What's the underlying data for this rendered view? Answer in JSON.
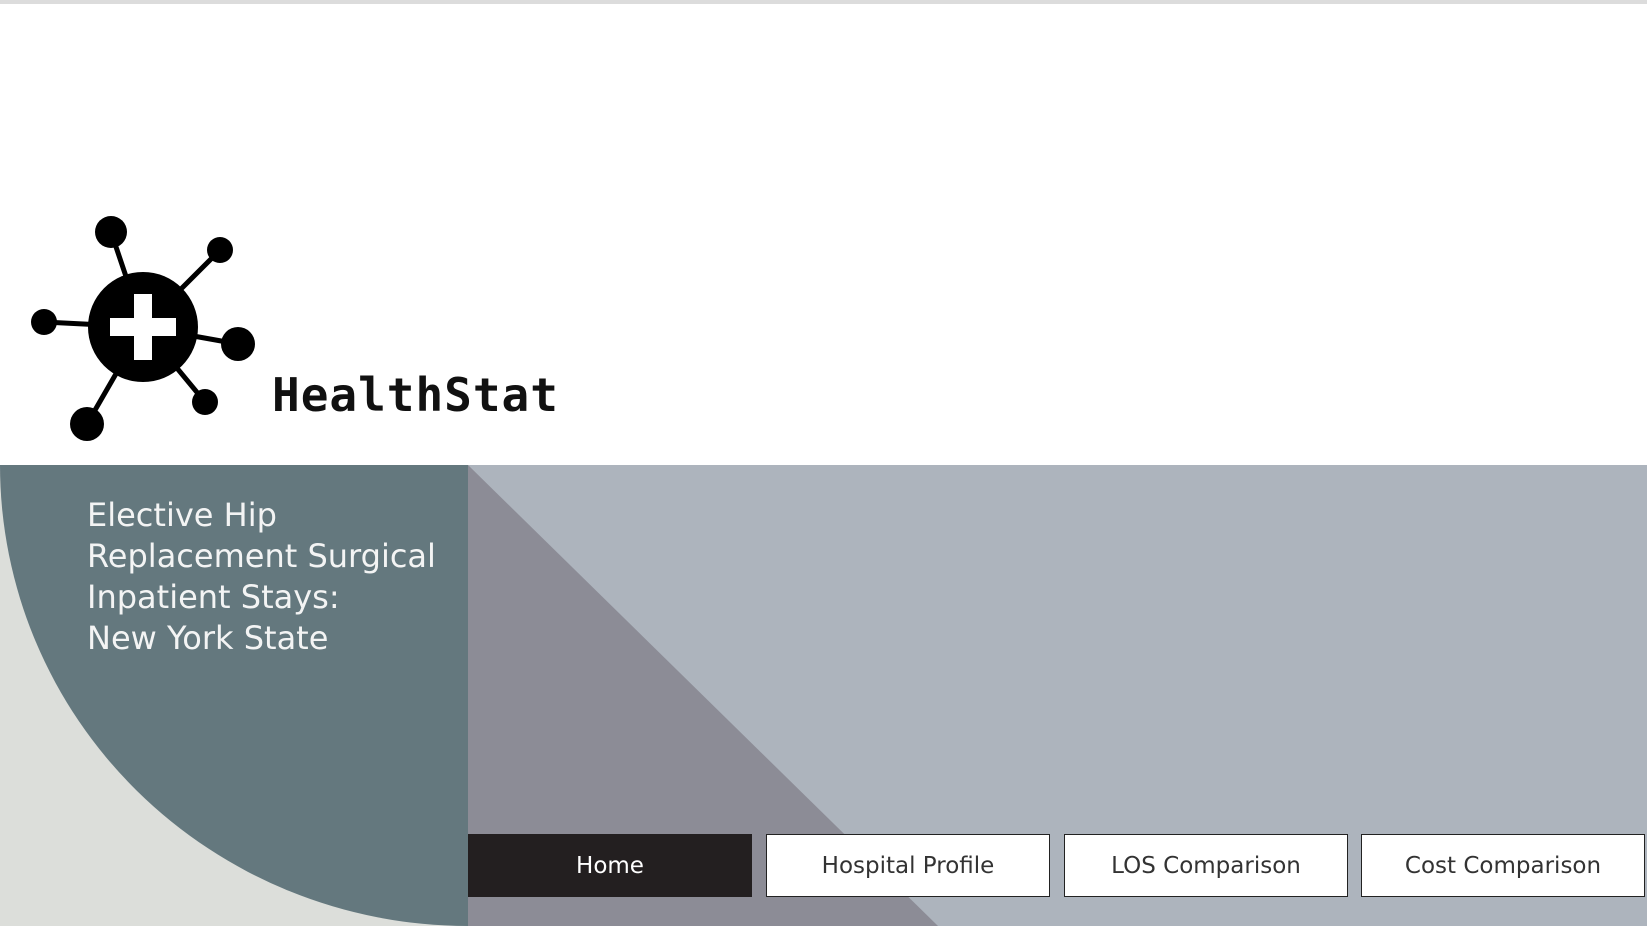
{
  "brand": {
    "logo_icon": "medical-cross-molecule-icon",
    "name": "HealthStat"
  },
  "banner": {
    "title_lines": [
      "Elective Hip",
      "Replacement Surgical",
      "Inpatient Stays:",
      "New York State"
    ]
  },
  "nav": {
    "items": [
      {
        "label": "Home",
        "active": true
      },
      {
        "label": "Hospital Profile",
        "active": false
      },
      {
        "label": "LOS Comparison",
        "active": false
      },
      {
        "label": "Cost Comparison",
        "active": false
      }
    ]
  },
  "colors": {
    "banner_background": "#adb4bd",
    "triangle": "#8c8c96",
    "quarter_circle": "#64787e",
    "corner_light": "#dcdeda",
    "active_nav": "#231f20",
    "title_text": "#f3f4f4"
  }
}
